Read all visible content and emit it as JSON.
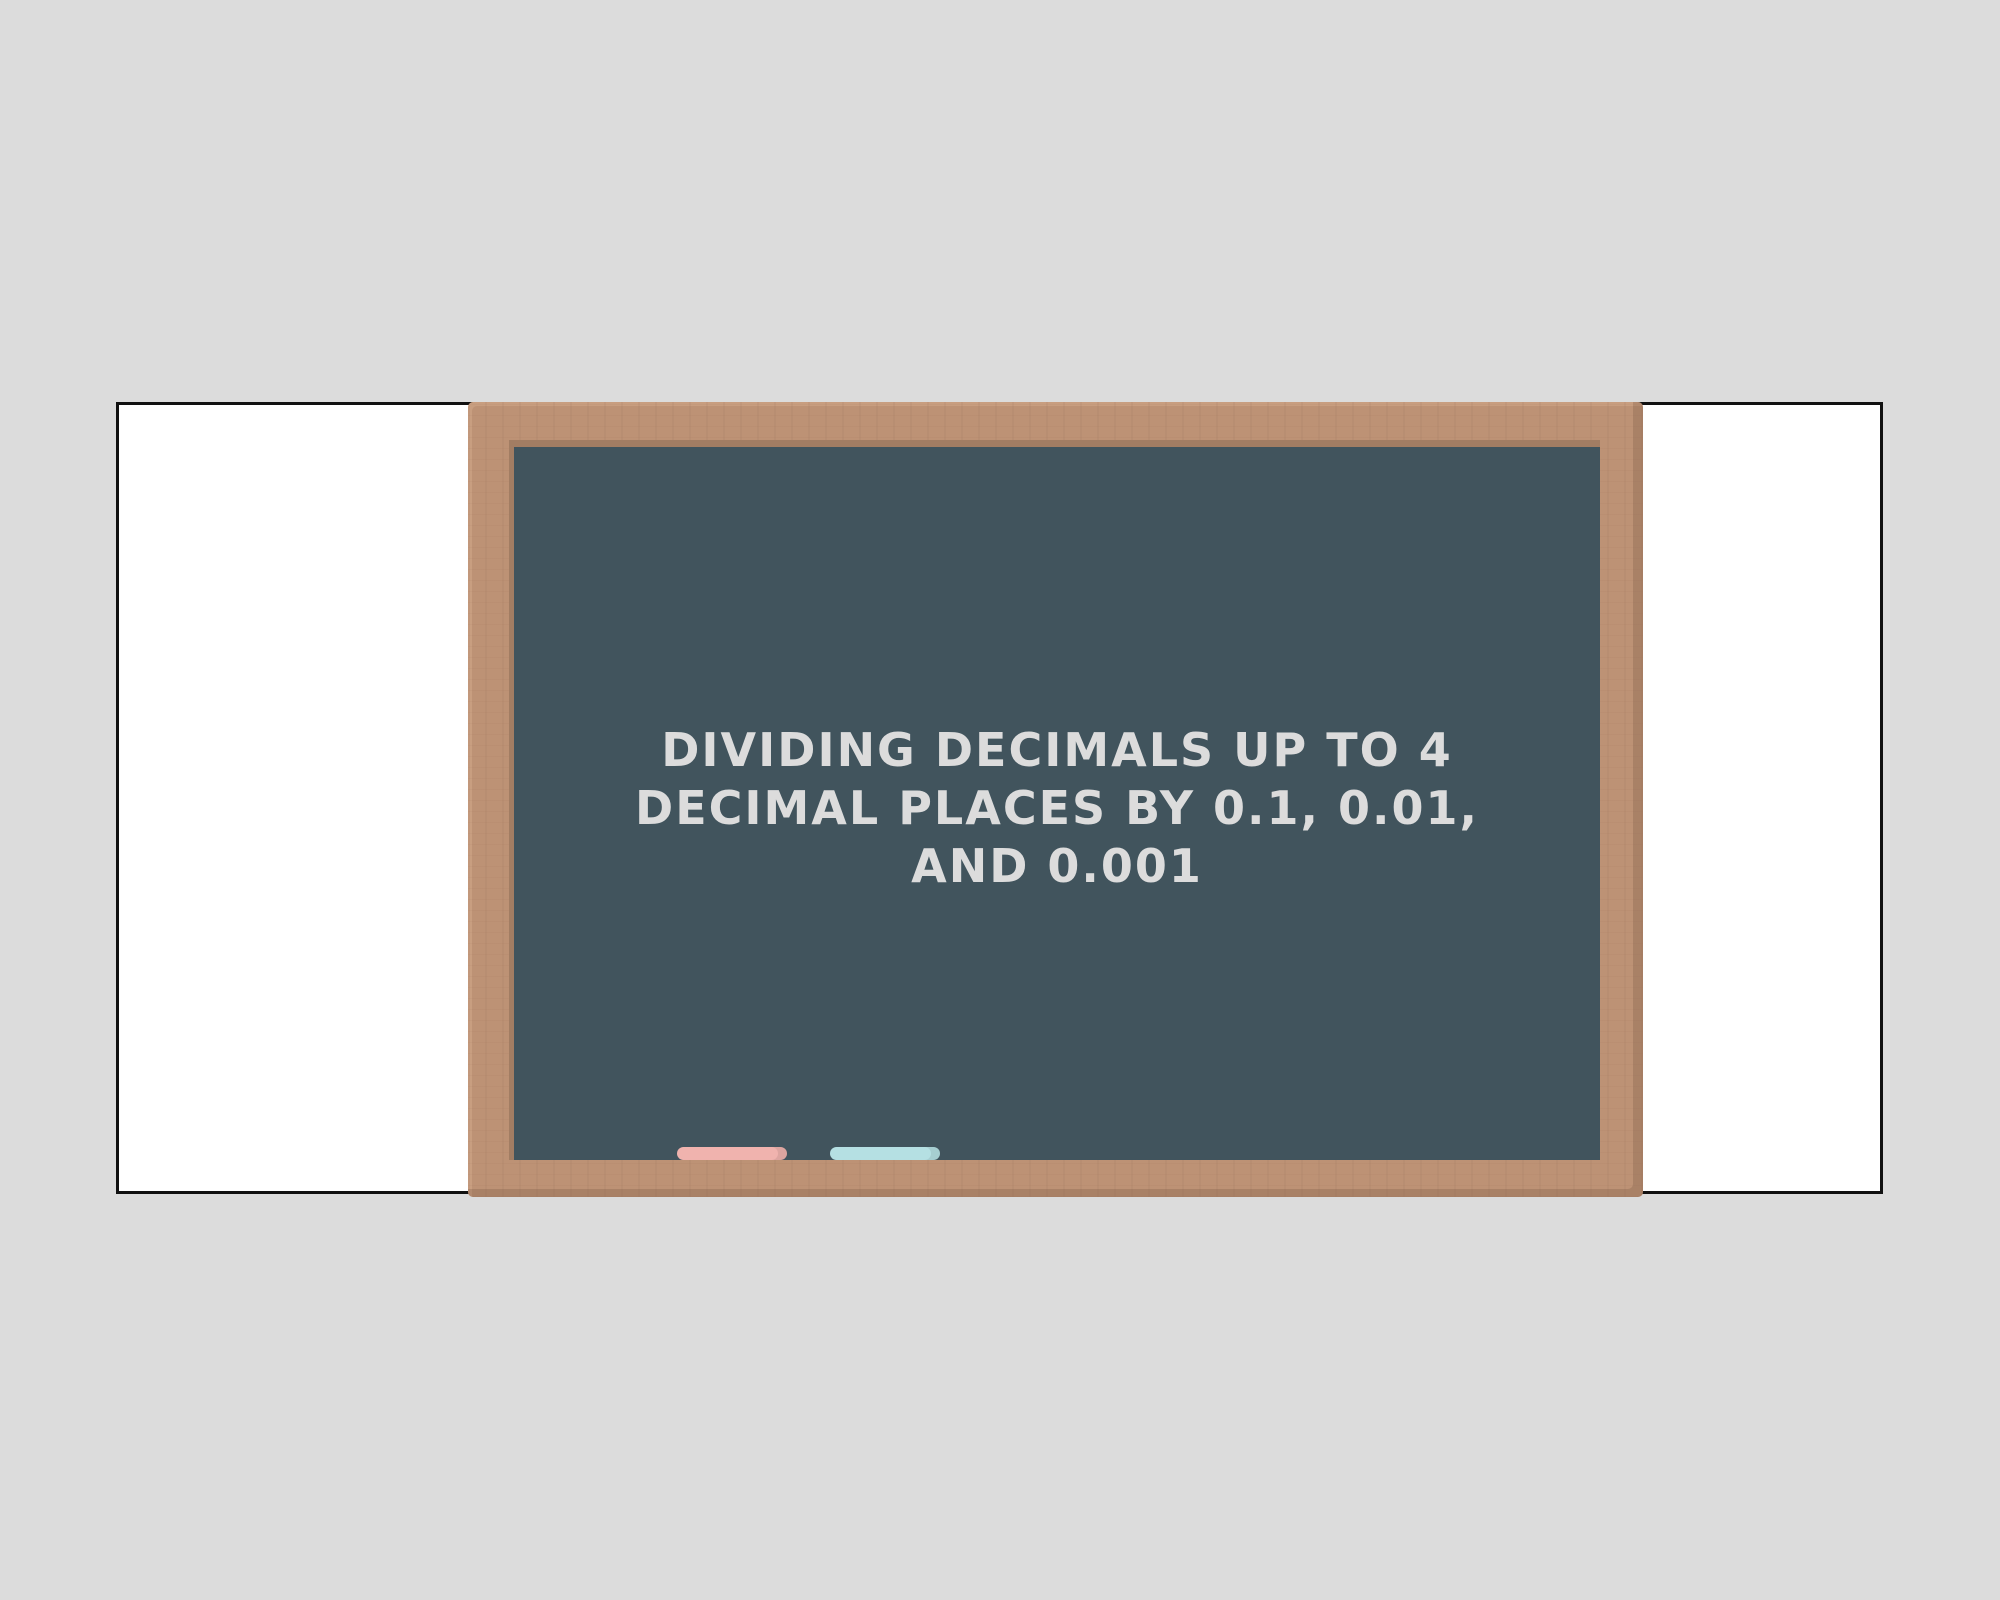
{
  "slide": {
    "title": "Dividing decimals up to 4 decimal places by 0.1, 0.01, and 0.001"
  },
  "colors": {
    "page_background": "#dcdcdc",
    "slide_background": "#ffffff",
    "board_surface": "#41545d",
    "frame_wood": "#bd9275",
    "chalk_text": "#dcdcdc",
    "chalk_pink": "#f0b3ae",
    "chalk_blue": "#b5e0e3"
  }
}
